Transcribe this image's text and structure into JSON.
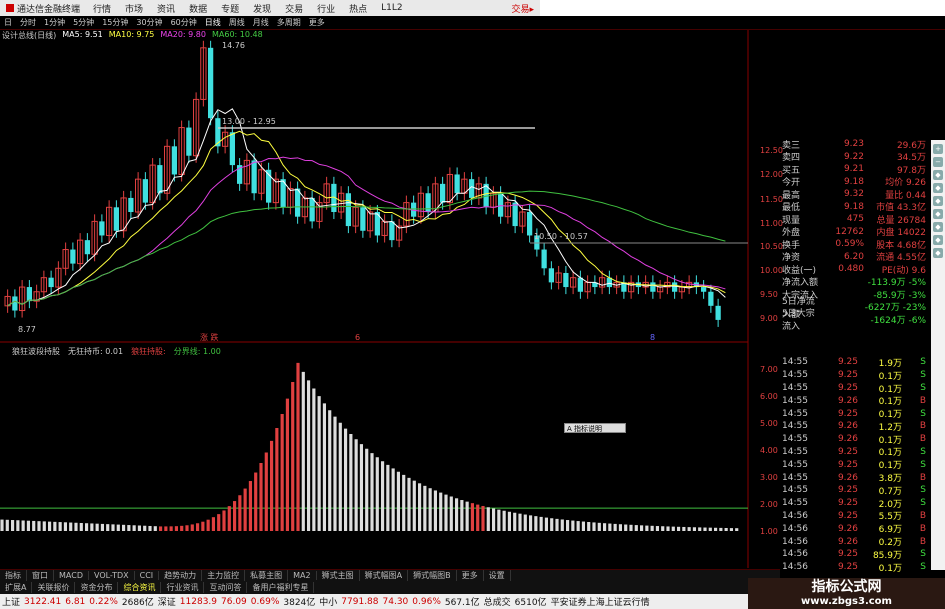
{
  "app": {
    "title": "通达信金融终端",
    "menu": [
      "行情",
      "市场",
      "资讯",
      "数据",
      "专题",
      "发现",
      "交易",
      "行业",
      "热点",
      "L1L2"
    ],
    "right_label": "交易▸"
  },
  "toolbar": {
    "items": [
      "日",
      "分时",
      "1分钟",
      "5分钟",
      "15分钟",
      "30分钟",
      "60分钟",
      "日线",
      "周线",
      "月线",
      "多周期",
      "更多"
    ],
    "active": "日线"
  },
  "chart_header": {
    "name": "设计总线(日线)",
    "ma5": "MA5: 9.51",
    "ma10": "MA10: 9.75",
    "ma20": "MA20: 9.80",
    "ma60": "MA60: 10.48"
  },
  "main_axis": [
    "12.50",
    "12.00",
    "11.50",
    "11.00",
    "10.50",
    "10.00",
    "9.50",
    "9.00"
  ],
  "annotations": {
    "high": "14.76",
    "low": "8.77",
    "mid1": "13.00 - 12.95",
    "mid2": "10.50 - 10.57"
  },
  "markers": {
    "m1": "涨 跌",
    "m2": "6",
    "m3": "8"
  },
  "sub_header": {
    "name": "狼狂波段持股",
    "label1": "无狂持币: 0.01",
    "label2": "狼狂持股:",
    "label3": "分界线: 1.00"
  },
  "sub_axis": [
    "7.00",
    "6.00",
    "5.00",
    "4.00",
    "3.00",
    "2.00",
    "1.00"
  ],
  "quote": {
    "rows": [
      {
        "l": "卖三",
        "m": "9.23",
        "r": "29.6万"
      },
      {
        "l": "卖四",
        "m": "9.22",
        "r": "34.5万"
      },
      {
        "l": "买五",
        "m": "9.21",
        "r": "97.8万"
      },
      {
        "l": "今开",
        "m": "9.18",
        "r": "均价 9.26"
      },
      {
        "l": "最高",
        "m": "9.32",
        "r": "量比 0.44"
      },
      {
        "l": "最低",
        "m": "9.18",
        "r": "市值 43.3亿"
      },
      {
        "l": "现量",
        "m": "475",
        "r": "总量 26784"
      },
      {
        "l": "外盘",
        "m": "12762",
        "r": "内盘 14022"
      },
      {
        "l": "换手",
        "m": "0.59%",
        "r": "股本 4.68亿"
      },
      {
        "l": "净资",
        "m": "6.20",
        "r": "流通 4.55亿"
      },
      {
        "l": "收益(一)",
        "m": "0.480",
        "r": "PE(动) 9.6"
      },
      {
        "l": "净流入额",
        "m": "",
        "r": "-113.9万 -5%"
      },
      {
        "l": "大宗流入",
        "m": "",
        "r": "-85.9万 -3%"
      },
      {
        "l": "5日净流入额",
        "m": "",
        "r": "-6227万 -23%"
      },
      {
        "l": "5日大宗流入",
        "m": "",
        "r": "-1624万 -6%"
      }
    ]
  },
  "ticks": [
    {
      "t": "14:55",
      "p": "9.25",
      "v": "1.9万",
      "s": "S"
    },
    {
      "t": "14:55",
      "p": "9.25",
      "v": "0.1万",
      "s": "S"
    },
    {
      "t": "14:55",
      "p": "9.25",
      "v": "0.1万",
      "s": "S"
    },
    {
      "t": "14:55",
      "p": "9.26",
      "v": "0.1万",
      "s": "B"
    },
    {
      "t": "14:55",
      "p": "9.25",
      "v": "0.1万",
      "s": "S"
    },
    {
      "t": "14:55",
      "p": "9.26",
      "v": "1.2万",
      "s": "B"
    },
    {
      "t": "14:55",
      "p": "9.26",
      "v": "0.1万",
      "s": "B"
    },
    {
      "t": "14:55",
      "p": "9.25",
      "v": "0.1万",
      "s": "S"
    },
    {
      "t": "14:55",
      "p": "9.25",
      "v": "0.1万",
      "s": "S"
    },
    {
      "t": "14:55",
      "p": "9.26",
      "v": "3.8万",
      "s": "B"
    },
    {
      "t": "14:55",
      "p": "9.25",
      "v": "0.7万",
      "s": "S"
    },
    {
      "t": "14:55",
      "p": "9.25",
      "v": "2.0万",
      "s": "S"
    },
    {
      "t": "14:56",
      "p": "9.25",
      "v": "5.5万",
      "s": "B"
    },
    {
      "t": "14:56",
      "p": "9.26",
      "v": "6.9万",
      "s": "B"
    },
    {
      "t": "14:56",
      "p": "9.26",
      "v": "0.2万",
      "s": "B"
    },
    {
      "t": "14:56",
      "p": "9.25",
      "v": "85.9万",
      "s": "S"
    },
    {
      "t": "14:56",
      "p": "9.25",
      "v": "0.1万",
      "s": "S"
    }
  ],
  "popup": "A 指标说明",
  "bottom_tabs": [
    "指标",
    "窗口",
    "MACD",
    "VOL-TDX",
    "CCI",
    "趋势动力",
    "主力监控",
    "私募主图",
    "MA2",
    "狮式主图",
    "狮式幅图A",
    "狮式幅图B",
    "更多",
    "设置"
  ],
  "bottom_tabs2": [
    "扩展A",
    "关联报价",
    "资金分布",
    "综合资讯",
    "行业资讯",
    "互动问答",
    "备用户福利专星"
  ],
  "status": {
    "sh_name": "上证",
    "sh_val": "3122.41",
    "sh_chg": "6.81",
    "sh_pct": "0.22%",
    "sh_amt": "2686亿",
    "sz_name": "深证",
    "sz_val": "11283.9",
    "sz_chg": "76.09",
    "sz_pct": "0.69%",
    "sz_amt": "3824亿",
    "zx_name": "中小",
    "zx_val": "7791.88",
    "zx_chg": "74.30",
    "zx_pct": "0.96%",
    "zx_amt": "567.1亿",
    "total_label": "总成交",
    "total_val": "6510亿",
    "broker": "平安证券上海上证云行情"
  },
  "watermark": {
    "line1": "指标公式网",
    "line2": "www.zbgs3.com"
  },
  "colors": {
    "up": "#e04040",
    "down": "#40e0e0",
    "ma5": "#ffffff",
    "ma10": "#ffff40",
    "ma20": "#e040e0",
    "ma60": "#40c040"
  }
}
